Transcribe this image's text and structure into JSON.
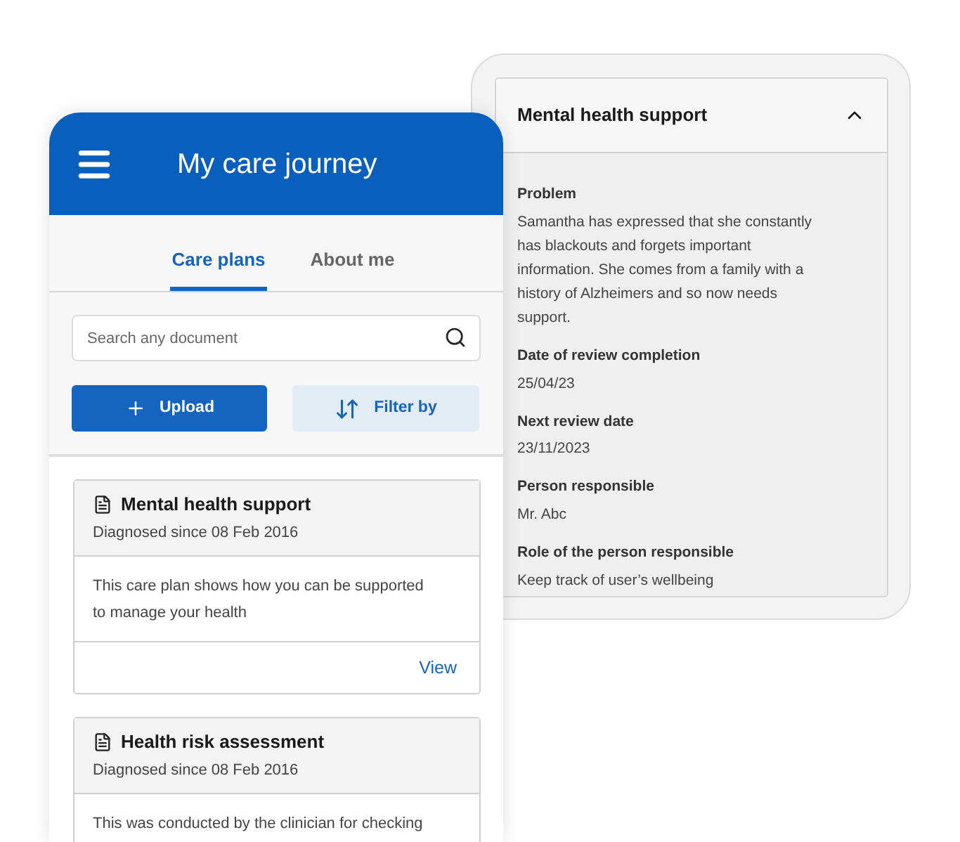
{
  "detail_panel": {
    "title": "Mental health support",
    "expanded": true,
    "fields": [
      {
        "label": "Problem",
        "value": "Samantha has expressed that she constantly has blackouts and forgets important information. She comes from a family with a history of Alzheimers and so now needs support."
      },
      {
        "label": "Date of review completion",
        "value": "25/04/23"
      },
      {
        "label": "Next review date",
        "value": "23/11/2023"
      },
      {
        "label": "Person responsible",
        "value": "Mr. Abc"
      },
      {
        "label": "Role of the person responsible",
        "value": "Keep track of user’s wellbeing"
      }
    ]
  },
  "app": {
    "title": "My care journey",
    "tabs": [
      {
        "label": "Care plans",
        "selected": true
      },
      {
        "label": "About me",
        "selected": false
      }
    ],
    "search": {
      "placeholder": "Search any document"
    },
    "buttons": [
      {
        "label": "Upload",
        "kind": "primary"
      },
      {
        "label": "Filter by",
        "kind": "secondary"
      }
    ],
    "cards": [
      {
        "title": "Mental health support",
        "subtitle": "Diagnosed since 08 Feb 2016",
        "body": "This care plan shows how you can be supported to manage your health",
        "action": "View"
      },
      {
        "title": "Health risk assessment",
        "subtitle": "Diagnosed since 08 Feb 2016",
        "body": "This was conducted by the clinician for checking"
      }
    ]
  }
}
